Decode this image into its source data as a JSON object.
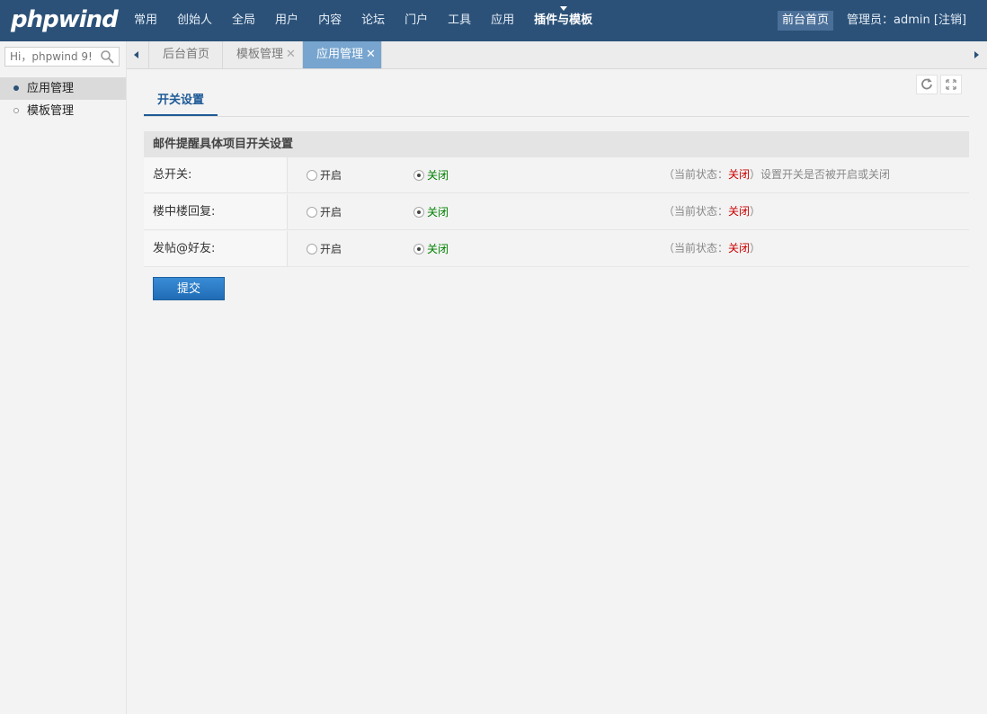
{
  "logo": "phpwind",
  "nav": {
    "items": [
      "常用",
      "创始人",
      "全局",
      "用户",
      "内容",
      "论坛",
      "门户",
      "工具",
      "应用",
      "插件与模板"
    ],
    "active_index": 9
  },
  "header": {
    "front_home": "前台首页",
    "admin_label": "管理员：",
    "admin_name": "admin",
    "logout": "[注销]"
  },
  "sidebar": {
    "search_placeholder": "Hi，phpwind 9!",
    "items": [
      {
        "label": "应用管理",
        "active": true
      },
      {
        "label": "模板管理",
        "active": false
      }
    ]
  },
  "tabs": [
    {
      "label": "后台首页",
      "closable": false,
      "active": false
    },
    {
      "label": "模板管理",
      "closable": true,
      "active": false
    },
    {
      "label": "应用管理",
      "closable": true,
      "active": true
    }
  ],
  "close_glyph": "✕",
  "subtab": "开关设置",
  "section_title": "邮件提醒具体项目开关设置",
  "option_on": "开启",
  "option_off": "关闭",
  "rows": [
    {
      "label": "总开关:",
      "status_prefix": "（当前状态：",
      "status_value": "关闭",
      "status_suffix": "）设置开关是否被开启或关闭",
      "selected": "off"
    },
    {
      "label": "楼中楼回复:",
      "status_prefix": "（当前状态：",
      "status_value": "关闭",
      "status_suffix": "）",
      "selected": "off"
    },
    {
      "label": "发帖@好友:",
      "status_prefix": "（当前状态：",
      "status_value": "关闭",
      "status_suffix": "）",
      "selected": "off"
    }
  ],
  "submit": "提交",
  "colors": {
    "topbar": "#2b5178",
    "active_tab": "#77a5cf",
    "off_text": "#008000",
    "status_value": "#cc0000"
  },
  "icons": {
    "search": "search-icon",
    "refresh": "refresh-icon",
    "fullscreen": "fullscreen-icon"
  }
}
